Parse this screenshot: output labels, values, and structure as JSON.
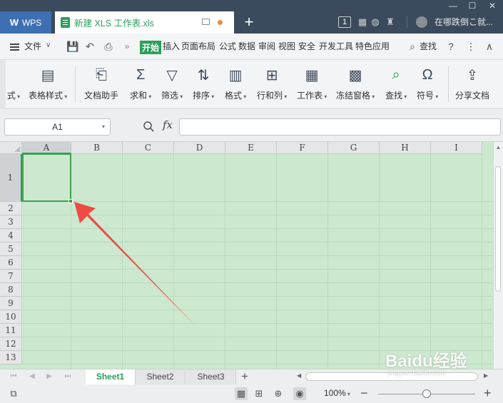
{
  "titlebar": {
    "app_tab": "WPS",
    "doc_title": "新建 XLS 工作表.xls",
    "new_tab": "+",
    "badge": "1",
    "user_name": "在哪跌倒こ就..."
  },
  "menubar": {
    "file": "文件",
    "tabs": [
      "开始",
      "插入",
      "页面布局",
      "公式",
      "数据",
      "审阅",
      "视图",
      "安全",
      "开发工具",
      "特色应用"
    ],
    "search": "查找"
  },
  "ribbon": {
    "items": [
      {
        "label": "式",
        "icon": "format-icon"
      },
      {
        "label": "表格样式",
        "icon": "table-style-icon"
      },
      {
        "label": "文档助手",
        "icon": "doc-assistant-icon"
      },
      {
        "label": "求和",
        "icon": "sum-icon"
      },
      {
        "label": "筛选",
        "icon": "filter-icon"
      },
      {
        "label": "排序",
        "icon": "sort-icon"
      },
      {
        "label": "格式",
        "icon": "format-icon"
      },
      {
        "label": "行和列",
        "icon": "rows-cols-icon"
      },
      {
        "label": "工作表",
        "icon": "worksheet-icon"
      },
      {
        "label": "冻结窗格",
        "icon": "freeze-icon"
      },
      {
        "label": "查找",
        "icon": "search-icon"
      },
      {
        "label": "符号",
        "icon": "omega-icon"
      },
      {
        "label": "分享文档",
        "icon": "share-icon"
      }
    ]
  },
  "formula": {
    "cell_ref": "A1",
    "fx": "fx",
    "value": ""
  },
  "grid": {
    "columns": [
      "A",
      "B",
      "C",
      "D",
      "E",
      "F",
      "G",
      "H",
      "I"
    ],
    "rows": [
      "1",
      "2",
      "3",
      "4",
      "5",
      "6",
      "7",
      "8",
      "9",
      "10",
      "11",
      "12",
      "13"
    ],
    "selected": "A1",
    "background": "#cce8cf"
  },
  "sheets": {
    "tabs": [
      "Sheet1",
      "Sheet2",
      "Sheet3"
    ],
    "active": "Sheet1",
    "add": "+"
  },
  "status": {
    "zoom": "100%",
    "minus": "−",
    "plus": "+",
    "zoom_level": 0.5
  },
  "watermark": {
    "main": "Baidu经验",
    "sub": "jingyan.baidu.com"
  },
  "colors": {
    "accent": "#2aa05a",
    "selection": "#3fa24e",
    "annotation": "#f04a45"
  }
}
